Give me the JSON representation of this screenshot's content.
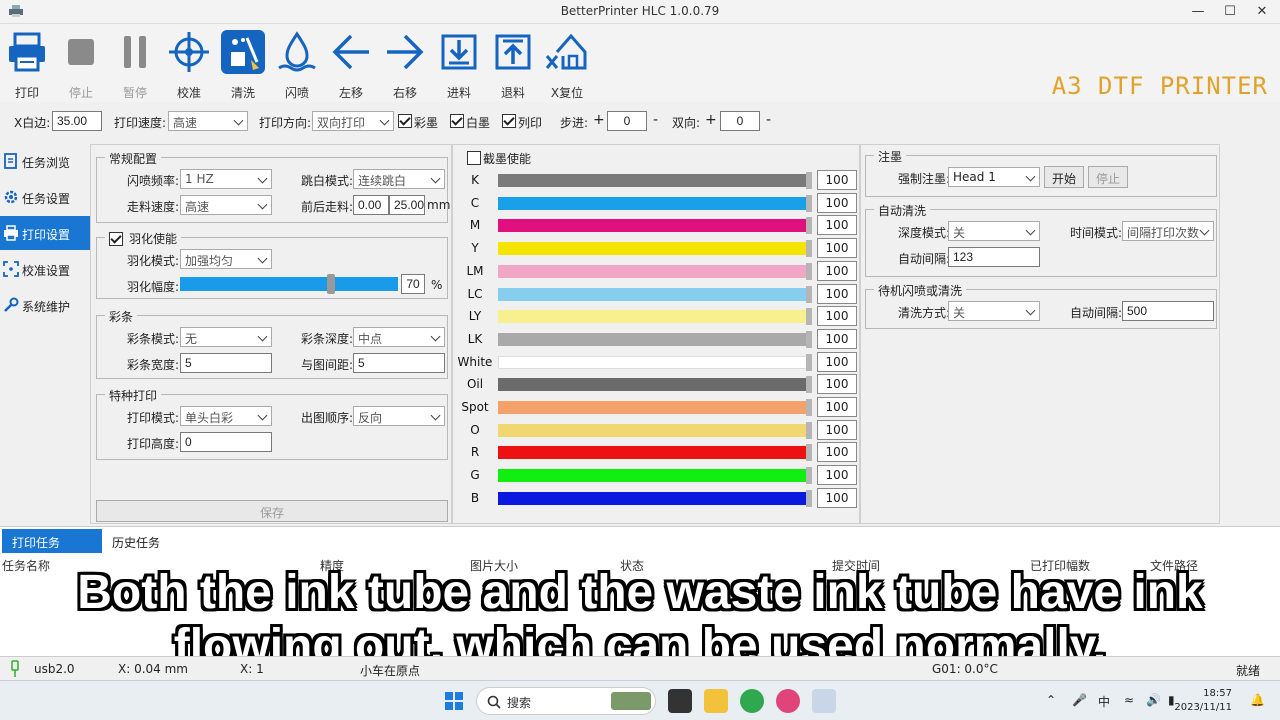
{
  "window": {
    "title": "BetterPrinter HLC 1.0.0.79"
  },
  "toolbar": {
    "items": [
      {
        "label": "打印",
        "icon": "printer-icon"
      },
      {
        "label": "停止",
        "icon": "stop-icon"
      },
      {
        "label": "暂停",
        "icon": "pause-icon"
      },
      {
        "label": "校准",
        "icon": "crosshair-icon"
      },
      {
        "label": "清洗",
        "icon": "clean-icon"
      },
      {
        "label": "闪喷",
        "icon": "flash-spray-icon"
      },
      {
        "label": "左移",
        "icon": "arrow-left-icon"
      },
      {
        "label": "右移",
        "icon": "arrow-right-icon"
      },
      {
        "label": "进料",
        "icon": "feed-in-icon"
      },
      {
        "label": "退料",
        "icon": "feed-out-icon"
      },
      {
        "label": "X复位",
        "icon": "x-home-icon"
      }
    ],
    "brand": "A3 DTF PRINTER"
  },
  "options": {
    "x_margin_label": "X白边:",
    "x_margin_value": "35.00",
    "speed_label": "打印速度:",
    "speed_value": "高速",
    "direction_label": "打印方向:",
    "direction_value": "双向打印",
    "color_ink": "彩墨",
    "white_ink": "白墨",
    "column_print": "列印",
    "step_label": "步进:",
    "step_value": "0",
    "bidir_label": "双向:",
    "bidir_value": "0"
  },
  "sidebar": {
    "items": [
      {
        "label": "任务浏览"
      },
      {
        "label": "任务设置"
      },
      {
        "label": "打印设置"
      },
      {
        "label": "校准设置"
      },
      {
        "label": "系统维护"
      }
    ]
  },
  "settings": {
    "general": {
      "title": "常规配置",
      "flash_freq_label": "闪喷频率:",
      "flash_freq_value": "1 HZ",
      "skip_white_label": "跳白模式:",
      "skip_white_value": "连续跳白",
      "feed_speed_label": "走料速度:",
      "feed_speed_value": "高速",
      "feed_fb_label": "前后走料:",
      "feed_fb_value1": "0.00",
      "feed_fb_value2": "25.00",
      "feed_fb_unit": "mm"
    },
    "feather": {
      "title": "羽化使能",
      "mode_label": "羽化模式:",
      "mode_value": "加强均匀",
      "amp_label": "羽化幅度:",
      "amp_value": "70",
      "amp_unit": "%"
    },
    "colorbar": {
      "title": "彩条",
      "mode_label": "彩条模式:",
      "mode_value": "无",
      "depth_label": "彩条深度:",
      "depth_value": "中点",
      "width_label": "彩条宽度:",
      "width_value": "5",
      "gap_label": "与图间距:",
      "gap_value": "5"
    },
    "special": {
      "title": "特种打印",
      "mode_label": "打印模式:",
      "mode_value": "单头白彩",
      "order_label": "出图顺序:",
      "order_value": "反向",
      "height_label": "打印高度:",
      "height_value": "0"
    },
    "save_label": "保存"
  },
  "inks": {
    "title": "截墨使能",
    "channels": [
      {
        "name": "K",
        "color": "#7a7a7a",
        "value": "100"
      },
      {
        "name": "C",
        "color": "#1aa0e8",
        "value": "100"
      },
      {
        "name": "M",
        "color": "#e0117f",
        "value": "100"
      },
      {
        "name": "Y",
        "color": "#f4e400",
        "value": "100"
      },
      {
        "name": "LM",
        "color": "#f2a6c6",
        "value": "100"
      },
      {
        "name": "LC",
        "color": "#86cdee",
        "value": "100"
      },
      {
        "name": "LY",
        "color": "#f6f08e",
        "value": "100"
      },
      {
        "name": "LK",
        "color": "#a9a9a9",
        "value": "100"
      },
      {
        "name": "White",
        "color": "#ffffff",
        "value": "100"
      },
      {
        "name": "Oil",
        "color": "#6b6b6b",
        "value": "100"
      },
      {
        "name": "Spot",
        "color": "#f2a26a",
        "value": "100"
      },
      {
        "name": "O",
        "color": "#f0d770",
        "value": "100"
      },
      {
        "name": "R",
        "color": "#ee1111",
        "value": "100"
      },
      {
        "name": "G",
        "color": "#11ee11",
        "value": "100"
      },
      {
        "name": "B",
        "color": "#0a18e0",
        "value": "100"
      }
    ]
  },
  "maintenance": {
    "inject": {
      "title": "注墨",
      "force_label": "强制注墨:",
      "head_value": "Head 1",
      "start_label": "开始",
      "stop_label": "停止"
    },
    "autoclean": {
      "title": "自动清洗",
      "depth_label": "深度模式:",
      "depth_value": "关",
      "time_label": "时间模式:",
      "time_value": "间隔打印次数",
      "interval_label": "自动间隔:",
      "interval_value": "123"
    },
    "idle": {
      "title": "待机闪喷或清洗",
      "method_label": "清洗方式:",
      "method_value": "关",
      "interval_label": "自动间隔:",
      "interval_value": "500"
    }
  },
  "tasks": {
    "tabs": [
      "打印任务",
      "历史任务"
    ],
    "columns": [
      "任务名称",
      "精度",
      "图片大小",
      "状态",
      "提交时间",
      "已打印幅数",
      "文件路径"
    ]
  },
  "subtitle": {
    "line1": "Both the ink tube and the waste ink tube have ink",
    "line2": "flowing out, which can be used normally."
  },
  "status": {
    "port": "usb2.0",
    "x_pos": "X: 0.04 mm",
    "x_count": "X: 1",
    "carriage": "小车在原点",
    "temp": "G01: 0.0°C",
    "ready": "就绪"
  },
  "taskbar": {
    "search": "搜索",
    "ime": "中",
    "time": "18:57",
    "date": "2023/11/11"
  }
}
